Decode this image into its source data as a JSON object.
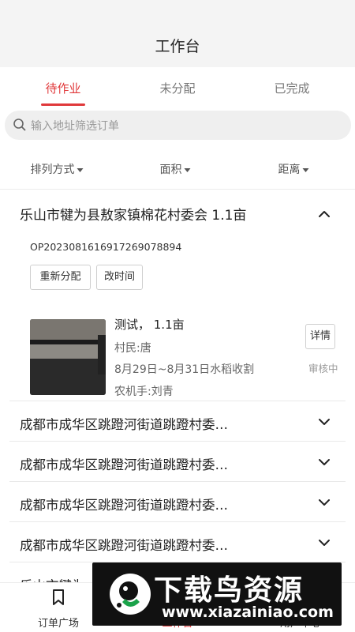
{
  "header": {
    "title": "工作台"
  },
  "tabs": [
    {
      "label": "待作业",
      "active": true
    },
    {
      "label": "未分配",
      "active": false
    },
    {
      "label": "已完成",
      "active": false
    }
  ],
  "search": {
    "placeholder": "输入地址筛选订单",
    "icon": "search-icon"
  },
  "filters": [
    {
      "label": "排列方式"
    },
    {
      "label": "面积"
    },
    {
      "label": "距离"
    }
  ],
  "expanded_order": {
    "title": "乐山市犍为县敖家镇棉花村委会 1.1亩",
    "order_no": "OP20230816169172690788948",
    "actions": {
      "reassign": "重新分配",
      "change_time": "改时间"
    },
    "task": {
      "title": "测试， 1.1亩",
      "farmer": "村民:唐",
      "schedule": "8月29日~8月31日水稻收割",
      "operator": "农机手:刘青",
      "detail_label": "详情",
      "status": "审核中"
    }
  },
  "orders": [
    {
      "title": "成都市成华区跳蹬河街道跳蹬村委…"
    },
    {
      "title": "成都市成华区跳蹬河街道跳蹬村委…"
    },
    {
      "title": "成都市成华区跳蹬河街道跳蹬村委…"
    },
    {
      "title": "成都市成华区跳蹬河街道跳蹬村委…"
    },
    {
      "title": "乐山市犍为…"
    }
  ],
  "bottom_nav": [
    {
      "label": "订单广场",
      "icon": "bookmark-icon",
      "active": false
    },
    {
      "label": "工作台",
      "icon": "workbench-icon",
      "active": true
    },
    {
      "label": "",
      "icon": "",
      "active": false
    },
    {
      "label": "用户中心",
      "icon": "user-icon",
      "active": false
    }
  ],
  "watermark": {
    "main": "下载鸟资源",
    "url": "www.xiazainiao.com"
  },
  "colors": {
    "accent": "#e0393b",
    "header_bg": "#f4f4f4",
    "search_bg": "#efefef"
  }
}
